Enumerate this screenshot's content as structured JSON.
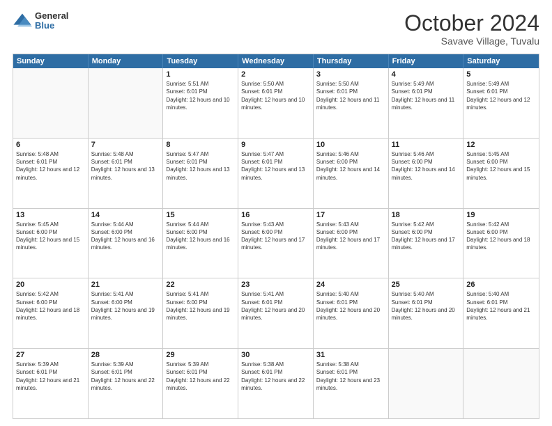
{
  "header": {
    "logo_general": "General",
    "logo_blue": "Blue",
    "month_title": "October 2024",
    "subtitle": "Savave Village, Tuvalu"
  },
  "calendar": {
    "days_of_week": [
      "Sunday",
      "Monday",
      "Tuesday",
      "Wednesday",
      "Thursday",
      "Friday",
      "Saturday"
    ],
    "weeks": [
      [
        {
          "day": "",
          "empty": true
        },
        {
          "day": "",
          "empty": true
        },
        {
          "day": "1",
          "sunrise": "5:51 AM",
          "sunset": "6:01 PM",
          "daylight": "12 hours and 10 minutes."
        },
        {
          "day": "2",
          "sunrise": "5:50 AM",
          "sunset": "6:01 PM",
          "daylight": "12 hours and 10 minutes."
        },
        {
          "day": "3",
          "sunrise": "5:50 AM",
          "sunset": "6:01 PM",
          "daylight": "12 hours and 11 minutes."
        },
        {
          "day": "4",
          "sunrise": "5:49 AM",
          "sunset": "6:01 PM",
          "daylight": "12 hours and 11 minutes."
        },
        {
          "day": "5",
          "sunrise": "5:49 AM",
          "sunset": "6:01 PM",
          "daylight": "12 hours and 12 minutes."
        }
      ],
      [
        {
          "day": "6",
          "sunrise": "5:48 AM",
          "sunset": "6:01 PM",
          "daylight": "12 hours and 12 minutes."
        },
        {
          "day": "7",
          "sunrise": "5:48 AM",
          "sunset": "6:01 PM",
          "daylight": "12 hours and 13 minutes."
        },
        {
          "day": "8",
          "sunrise": "5:47 AM",
          "sunset": "6:01 PM",
          "daylight": "12 hours and 13 minutes."
        },
        {
          "day": "9",
          "sunrise": "5:47 AM",
          "sunset": "6:01 PM",
          "daylight": "12 hours and 13 minutes."
        },
        {
          "day": "10",
          "sunrise": "5:46 AM",
          "sunset": "6:00 PM",
          "daylight": "12 hours and 14 minutes."
        },
        {
          "day": "11",
          "sunrise": "5:46 AM",
          "sunset": "6:00 PM",
          "daylight": "12 hours and 14 minutes."
        },
        {
          "day": "12",
          "sunrise": "5:45 AM",
          "sunset": "6:00 PM",
          "daylight": "12 hours and 15 minutes."
        }
      ],
      [
        {
          "day": "13",
          "sunrise": "5:45 AM",
          "sunset": "6:00 PM",
          "daylight": "12 hours and 15 minutes."
        },
        {
          "day": "14",
          "sunrise": "5:44 AM",
          "sunset": "6:00 PM",
          "daylight": "12 hours and 16 minutes."
        },
        {
          "day": "15",
          "sunrise": "5:44 AM",
          "sunset": "6:00 PM",
          "daylight": "12 hours and 16 minutes."
        },
        {
          "day": "16",
          "sunrise": "5:43 AM",
          "sunset": "6:00 PM",
          "daylight": "12 hours and 17 minutes."
        },
        {
          "day": "17",
          "sunrise": "5:43 AM",
          "sunset": "6:00 PM",
          "daylight": "12 hours and 17 minutes."
        },
        {
          "day": "18",
          "sunrise": "5:42 AM",
          "sunset": "6:00 PM",
          "daylight": "12 hours and 17 minutes."
        },
        {
          "day": "19",
          "sunrise": "5:42 AM",
          "sunset": "6:00 PM",
          "daylight": "12 hours and 18 minutes."
        }
      ],
      [
        {
          "day": "20",
          "sunrise": "5:42 AM",
          "sunset": "6:00 PM",
          "daylight": "12 hours and 18 minutes."
        },
        {
          "day": "21",
          "sunrise": "5:41 AM",
          "sunset": "6:00 PM",
          "daylight": "12 hours and 19 minutes."
        },
        {
          "day": "22",
          "sunrise": "5:41 AM",
          "sunset": "6:00 PM",
          "daylight": "12 hours and 19 minutes."
        },
        {
          "day": "23",
          "sunrise": "5:41 AM",
          "sunset": "6:01 PM",
          "daylight": "12 hours and 20 minutes."
        },
        {
          "day": "24",
          "sunrise": "5:40 AM",
          "sunset": "6:01 PM",
          "daylight": "12 hours and 20 minutes."
        },
        {
          "day": "25",
          "sunrise": "5:40 AM",
          "sunset": "6:01 PM",
          "daylight": "12 hours and 20 minutes."
        },
        {
          "day": "26",
          "sunrise": "5:40 AM",
          "sunset": "6:01 PM",
          "daylight": "12 hours and 21 minutes."
        }
      ],
      [
        {
          "day": "27",
          "sunrise": "5:39 AM",
          "sunset": "6:01 PM",
          "daylight": "12 hours and 21 minutes."
        },
        {
          "day": "28",
          "sunrise": "5:39 AM",
          "sunset": "6:01 PM",
          "daylight": "12 hours and 22 minutes."
        },
        {
          "day": "29",
          "sunrise": "5:39 AM",
          "sunset": "6:01 PM",
          "daylight": "12 hours and 22 minutes."
        },
        {
          "day": "30",
          "sunrise": "5:38 AM",
          "sunset": "6:01 PM",
          "daylight": "12 hours and 22 minutes."
        },
        {
          "day": "31",
          "sunrise": "5:38 AM",
          "sunset": "6:01 PM",
          "daylight": "12 hours and 23 minutes."
        },
        {
          "day": "",
          "empty": true
        },
        {
          "day": "",
          "empty": true
        }
      ]
    ]
  }
}
